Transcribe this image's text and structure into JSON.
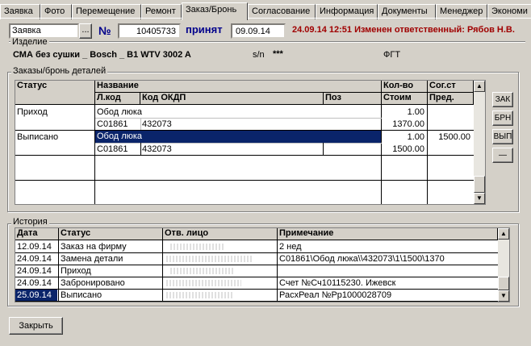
{
  "tabs": [
    "Заявка",
    "Фото",
    "Перемещение",
    "Ремонт",
    "Заказ/Бронь",
    "Согласование",
    "Информация",
    "Документы",
    "Менеджер",
    "Экономи"
  ],
  "active_tab": "Заказ/Бронь",
  "top": {
    "doc_type": "Заявка",
    "ellipsis": "...",
    "number_label": "№",
    "number": "10405733",
    "status": "принят",
    "date": "09.09.14",
    "notice": "24.09.14 12:51 Изменен ответственный: Рябов Н.В."
  },
  "product": {
    "label": "Изделие",
    "name": "СМА без сушки _ Bosch _ B1 WTV 3002 A",
    "sn_label": "s/n",
    "sn": "***",
    "code": "ФГТ"
  },
  "orders": {
    "label": "Заказы/бронь деталей",
    "headers": {
      "status": "Статус",
      "name": "Название",
      "lcode": "Л.код",
      "okdp": "Код ОКДП",
      "pos": "Поз",
      "qty": "Кол-во",
      "cost": "Стоим",
      "agreed": "Сог.ст",
      "prev": "Пред."
    },
    "rows": [
      {
        "status": "Приход",
        "name": "Обод люка",
        "lcode": "C01861",
        "okdp": "432073",
        "pos": "",
        "qty": "1.00",
        "cost": "1370.00",
        "agreed": "",
        "prev": ""
      },
      {
        "status": "Выписано",
        "name": "Обод люка",
        "lcode": "C01861",
        "okdp": "432073",
        "pos": "",
        "qty": "1.00",
        "cost": "1500.00",
        "agreed": "1500.00",
        "prev": ""
      }
    ],
    "buttons": [
      "ЗАК",
      "БРН",
      "ВЫП",
      "—"
    ]
  },
  "history": {
    "label": "История",
    "headers": {
      "date": "Дата",
      "status": "Статус",
      "person": "Отв. лицо",
      "note": "Примечание"
    },
    "rows": [
      {
        "date": "12.09.14",
        "status": "Заказ на фирму",
        "note": "2 нед"
      },
      {
        "date": "24.09.14",
        "status": "Замена детали",
        "note": "C01861\\Обод люка\\\\432073\\1\\1500\\1370"
      },
      {
        "date": "24.09.14",
        "status": "Приход",
        "note": ""
      },
      {
        "date": "24.09.14",
        "status": "Забронировано",
        "note": "Счет №Сч10115230. Ижевск"
      },
      {
        "date": "25.09.14",
        "status": "Выписано",
        "note": "РасхРеал №Рр1000028709"
      }
    ]
  },
  "close_button": "Закрыть",
  "colors": {
    "accent": "#0a246a",
    "notice": "#a00000",
    "number_label": "#00008b"
  }
}
